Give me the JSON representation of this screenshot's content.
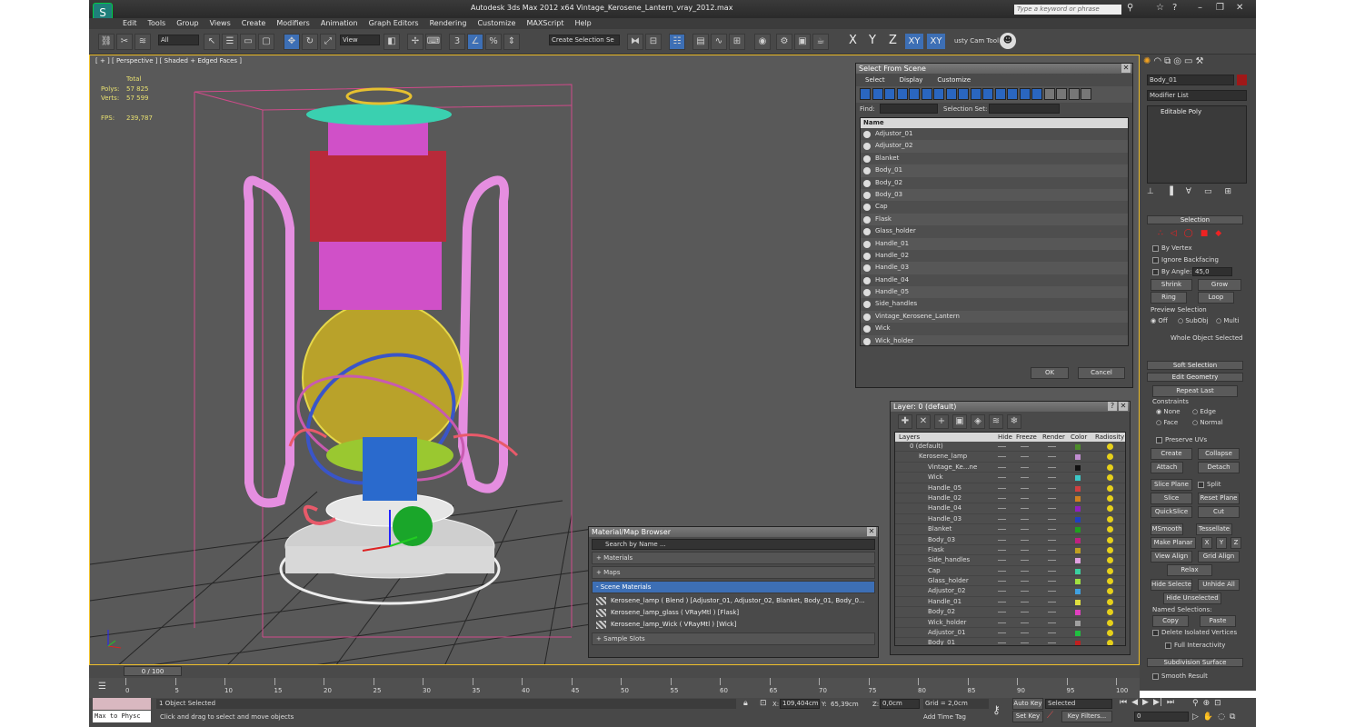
{
  "window": {
    "title": "Autodesk 3ds Max  2012 x64     Vintage_Kerosene_Lantern_vray_2012.max",
    "search_placeholder": "Type a keyword or phrase"
  },
  "menu": [
    "Edit",
    "Tools",
    "Group",
    "Views",
    "Create",
    "Modifiers",
    "Animation",
    "Graph Editors",
    "Rendering",
    "Customize",
    "MAXScript",
    "Help"
  ],
  "toolbar": {
    "filter_value": "All",
    "view_value": "View",
    "selection_set": "Create Selection Se",
    "axis_x": "X",
    "axis_y": "Y",
    "axis_z": "Z",
    "axis_xy": "XY",
    "axis_xy2": "XY",
    "cam_tool": "usty Cam Tool v"
  },
  "viewport": {
    "label": "[ + ] [ Perspective ] [ Shaded + Edged Faces ]",
    "stats_total": "Total",
    "polys_label": "Polys:",
    "polys_value": "57 825",
    "verts_label": "Verts:",
    "verts_value": "57 599",
    "fps_label": "FPS:",
    "fps_value": "239,787"
  },
  "select_from_scene": {
    "title": "Select From Scene",
    "menu": [
      "Select",
      "Display",
      "Customize"
    ],
    "find_label": "Find:",
    "selection_set_label": "Selection Set:",
    "column_name": "Name",
    "items": [
      "Adjustor_01",
      "Adjustor_02",
      "Blanket",
      "Body_01",
      "Body_02",
      "Body_03",
      "Cap",
      "Flask",
      "Glass_holder",
      "Handle_01",
      "Handle_02",
      "Handle_03",
      "Handle_04",
      "Handle_05",
      "Side_handles",
      "Vintage_Kerosene_Lantern",
      "Wick",
      "Wick_holder"
    ],
    "ok": "OK",
    "cancel": "Cancel"
  },
  "layer_dialog": {
    "title": "Layer: 0 (default)",
    "columns": [
      "Layers",
      "Hide",
      "Freeze",
      "Render",
      "Color",
      "Radiosity"
    ],
    "rows": [
      {
        "name": "0 (default)",
        "color": "#4d8c2a",
        "indent": 0
      },
      {
        "name": "Kerosene_lamp",
        "color": "#c08cd0",
        "indent": 1
      },
      {
        "name": "Vintage_Ke...ne",
        "color": "#111111",
        "indent": 2
      },
      {
        "name": "Wick",
        "color": "#3cc8c8",
        "indent": 2
      },
      {
        "name": "Handle_05",
        "color": "#d04040",
        "indent": 2
      },
      {
        "name": "Handle_02",
        "color": "#d08020",
        "indent": 2
      },
      {
        "name": "Handle_04",
        "color": "#9020c0",
        "indent": 2
      },
      {
        "name": "Handle_03",
        "color": "#2040c0",
        "indent": 2
      },
      {
        "name": "Blanket",
        "color": "#20a020",
        "indent": 2
      },
      {
        "name": "Body_03",
        "color": "#c02080",
        "indent": 2
      },
      {
        "name": "Flask",
        "color": "#c0a020",
        "indent": 2
      },
      {
        "name": "Side_handles",
        "color": "#e0a0e0",
        "indent": 2
      },
      {
        "name": "Cap",
        "color": "#3ad0a0",
        "indent": 2
      },
      {
        "name": "Glass_holder",
        "color": "#a0e040",
        "indent": 2
      },
      {
        "name": "Adjustor_02",
        "color": "#40a0e0",
        "indent": 2
      },
      {
        "name": "Handle_01",
        "color": "#e0e040",
        "indent": 2
      },
      {
        "name": "Body_02",
        "color": "#e040c0",
        "indent": 2
      },
      {
        "name": "Wick_holder",
        "color": "#a0a0a0",
        "indent": 2
      },
      {
        "name": "Adjustor_01",
        "color": "#20c040",
        "indent": 2
      },
      {
        "name": "Body_01",
        "color": "#c02020",
        "indent": 2
      }
    ]
  },
  "material_browser": {
    "title": "Material/Map Browser",
    "search_placeholder": "Search by Name ...",
    "sections": [
      "+ Materials",
      "+ Maps",
      "- Scene Materials",
      "+ Sample Slots"
    ],
    "materials": [
      "Kerosene_lamp  ( Blend ) [Adjustor_01, Adjustor_02, Blanket, Body_01, Body_0...",
      "Kerosene_lamp_glass  ( VRayMtl ) [Flask]",
      "Kerosene_lamp_Wick  ( VRayMtl ) [Wick]"
    ]
  },
  "command_panel": {
    "object_name": "Body_01",
    "modifier_list": "Modifier List",
    "stack_item": "Editable Poly",
    "selection_header": "Selection",
    "by_vertex": "By Vertex",
    "ignore_backfacing": "Ignore Backfacing",
    "by_angle": "By Angle:",
    "angle_value": "45,0",
    "shrink": "Shrink",
    "grow": "Grow",
    "ring": "Ring",
    "loop": "Loop",
    "preview_selection": "Preview Selection",
    "off": "Off",
    "subobj": "SubObj",
    "multi": "Multi",
    "whole_object": "Whole Object Selected",
    "soft_selection": "Soft Selection",
    "edit_geometry": "Edit Geometry",
    "repeat_last": "Repeat Last",
    "constraints": "Constraints",
    "none": "None",
    "edge": "Edge",
    "face": "Face",
    "normal": "Normal",
    "preserve_uvs": "Preserve UVs",
    "create": "Create",
    "collapse": "Collapse",
    "attach": "Attach",
    "detach": "Detach",
    "slice_plane": "Slice Plane",
    "split": "Split",
    "slice": "Slice",
    "reset_plane": "Reset Plane",
    "quickslice": "QuickSlice",
    "cut": "Cut",
    "msmooth": "MSmooth",
    "tessellate": "Tessellate",
    "make_planar": "Make Planar",
    "x": "X",
    "y": "Y",
    "z": "Z",
    "view_align": "View Align",
    "grid_align": "Grid Align",
    "relax": "Relax",
    "hide_selected": "Hide Selected",
    "unhide_all": "Unhide All",
    "hide_unselected": "Hide Unselected",
    "named_selections": "Named Selections:",
    "copy": "Copy",
    "paste": "Paste",
    "delete_isolated": "Delete Isolated Vertices",
    "full_interactivity": "Full Interactivity",
    "subdivision_surface": "Subdivision Surface",
    "smooth_result": "Smooth Result"
  },
  "timeline": {
    "frame": "0 / 100",
    "ticks": [
      "0",
      "5",
      "10",
      "15",
      "20",
      "25",
      "30",
      "35",
      "40",
      "45",
      "50",
      "55",
      "60",
      "65",
      "70",
      "75",
      "80",
      "85",
      "90",
      "95",
      "100"
    ]
  },
  "status": {
    "maxscript": "Max to Physc",
    "selected_count": "1 Object Selected",
    "prompt": "Click and drag to select and move objects",
    "x_label": "X:",
    "x_value": "109,404cm",
    "y_label": "Y:",
    "y_value": "65,39cm",
    "z_label": "Z:",
    "z_value": "0,0cm",
    "grid": "Grid = 2,0cm",
    "add_time_tag": "Add Time Tag",
    "auto_key": "Auto Key",
    "set_key": "Set Key",
    "selected_dropdown": "Selected",
    "key_filters": "Key Filters...",
    "frame_value": "0"
  }
}
